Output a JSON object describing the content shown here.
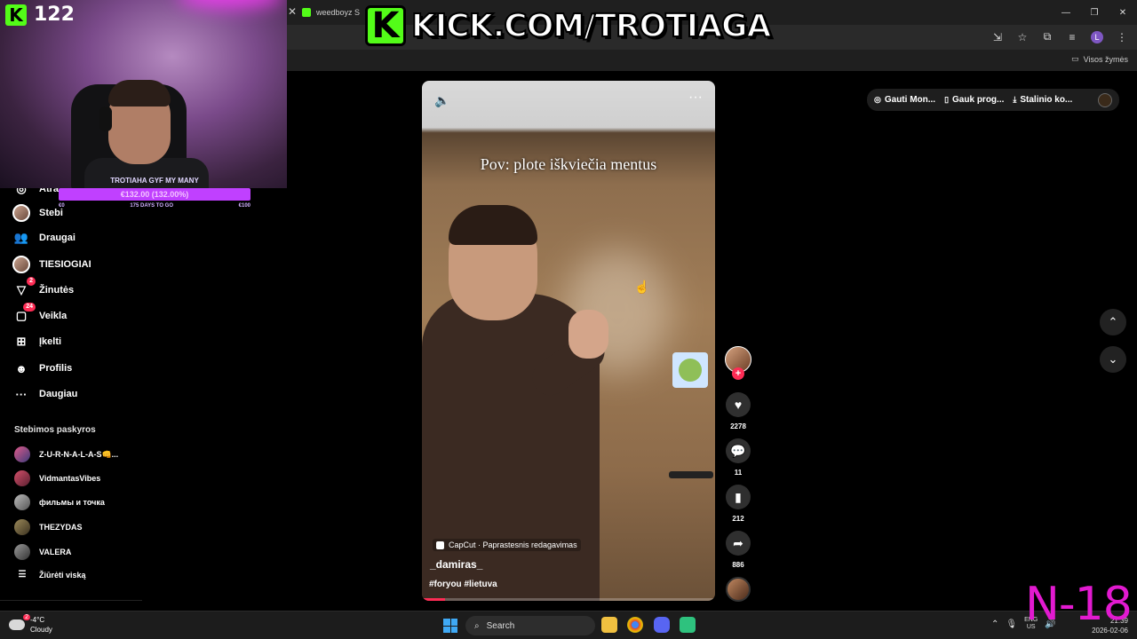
{
  "browser": {
    "tab_title": "weedboyz S",
    "bookmarks_all": "Visos žymės"
  },
  "stream": {
    "viewer_count": "122",
    "banner_url": "KICK.COM/TROTIAGA",
    "goal_title": "TROTIAHA GYF MY MANY",
    "goal_progress": "€132.00 (132.00%)",
    "goal_progress_fraction": 1.0,
    "goal_left": "€0",
    "goal_days": "175 DAYS TO GO",
    "goal_target": "€100",
    "watermark": "N-18"
  },
  "sidebar": {
    "items": [
      {
        "label": "Atra...",
        "icon": "compass-icon"
      },
      {
        "label": "Stebi",
        "icon": "avatar"
      },
      {
        "label": "Draugai",
        "icon": "friends-icon"
      },
      {
        "label": "TIESIOGIAI",
        "icon": "live-avatar"
      },
      {
        "label": "Žinutės",
        "icon": "inbox-icon",
        "badge": "2"
      },
      {
        "label": "Veikla",
        "icon": "activity-icon",
        "badge": "24"
      },
      {
        "label": "Įkelti",
        "icon": "upload-icon"
      },
      {
        "label": "Profilis",
        "icon": "profile-icon"
      },
      {
        "label": "Daugiau",
        "icon": "more-icon"
      }
    ],
    "following_title": "Stebimos paskyros",
    "following": [
      {
        "name": "Z-U-R-N-A-L-A-S👊..."
      },
      {
        "name": "VidmantasVibes"
      },
      {
        "name": "фильмы и точка"
      },
      {
        "name": "THEZYDAS"
      },
      {
        "name": "VALERA"
      }
    ],
    "see_all": "Žiūrėti viską"
  },
  "video": {
    "caption": "Pov: plote iškviečia mentus",
    "capcut": "CapCut · Paprastesnis redagavimas",
    "author": "_damiras_",
    "hashtags": "#foryou #lietuva",
    "progress_fraction": 0.08
  },
  "actions": {
    "likes": "2278",
    "comments": "11",
    "saves": "212",
    "shares": "886"
  },
  "top_actions": {
    "coins": "Gauti Mon...",
    "app": "Gauk prog...",
    "desktop": "Stalinio ko..."
  },
  "taskbar": {
    "temp": "-4°C",
    "weather": "Cloudy",
    "search": "Search",
    "lang_top": "ENG",
    "lang_bottom": "US",
    "time": "21:39",
    "date": "2026-02-06"
  }
}
